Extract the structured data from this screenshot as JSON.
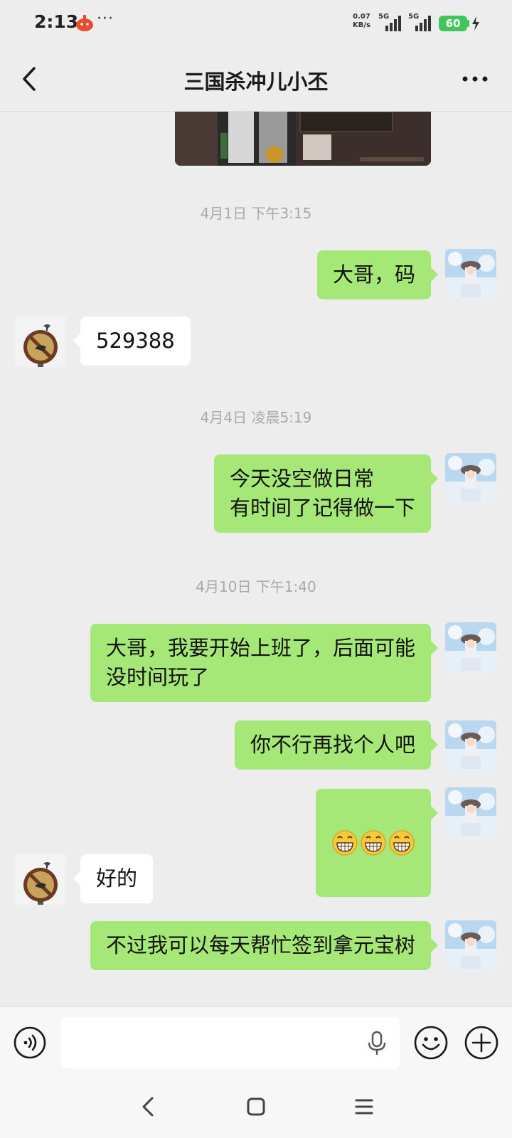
{
  "status_bar": {
    "time": "2:13",
    "more": "···",
    "net_speed_value": "0.07",
    "net_speed_unit": "KB/s",
    "signal_1": "5G",
    "signal_2": "5G",
    "battery": "60"
  },
  "header": {
    "title": "三国杀冲儿小丕"
  },
  "messages": [
    {
      "type": "timestamp",
      "text": "4月1日 下午3:15"
    },
    {
      "type": "outgoing",
      "text": "大哥，码"
    },
    {
      "type": "incoming",
      "text": "529388"
    },
    {
      "type": "timestamp",
      "text": "4月4日 凌晨5:19"
    },
    {
      "type": "outgoing",
      "text": "今天没空做日常\n有时间了记得做一下"
    },
    {
      "type": "timestamp",
      "text": "4月10日 下午1:40"
    },
    {
      "type": "outgoing",
      "text": "大哥，我要开始上班了，后面可能\n没时间玩了"
    },
    {
      "type": "outgoing",
      "text": "你不行再找个人吧"
    },
    {
      "type": "outgoing-emoji",
      "emoji": [
        "grin-icon",
        "grin-icon",
        "grin-icon"
      ]
    },
    {
      "type": "incoming",
      "text": "好的"
    },
    {
      "type": "outgoing",
      "text": "不过我可以每天帮忙签到拿元宝树"
    }
  ],
  "input": {
    "value": "",
    "placeholder": ""
  },
  "colors": {
    "background": "#ededed",
    "outgoing_bubble": "#a6e878",
    "incoming_bubble": "#ffffff",
    "timestamp": "#a9a9a9",
    "battery": "#41c55a"
  }
}
